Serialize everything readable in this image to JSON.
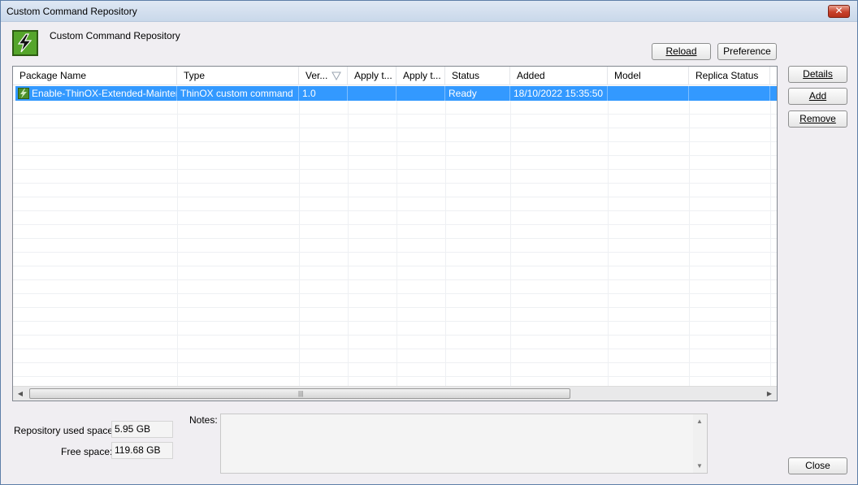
{
  "window": {
    "title": "Custom Command Repository",
    "close_label": "✕"
  },
  "header": {
    "label": "Custom Command Repository"
  },
  "toolbar": {
    "reload_label": "Reload",
    "preference_label": "Preference"
  },
  "side_buttons": {
    "details_label": "Details",
    "add_label": "Add",
    "remove_label": "Remove",
    "close_label": "Close"
  },
  "columns": [
    "Package Name",
    "Type",
    "Ver...",
    "Apply t...",
    "Apply t...",
    "Status",
    "Added",
    "Model",
    "Replica Status"
  ],
  "rows": [
    {
      "package_name": "Enable-ThinOX-Extended-Maintena...",
      "type": "ThinOX custom command",
      "version": "1.0",
      "apply_to_1": "",
      "apply_to_2": "",
      "status": "Ready",
      "added": "18/10/2022 15:35:50",
      "model": "",
      "replica_status": ""
    }
  ],
  "storage": {
    "used_label": "Repository used space:",
    "used_value": "5.95 GB",
    "free_label": "Free space:",
    "free_value": "119.68 GB"
  },
  "notes": {
    "label": "Notes:",
    "value": ""
  },
  "colors": {
    "selection": "#3399ff",
    "icon_green": "#55a52b"
  }
}
